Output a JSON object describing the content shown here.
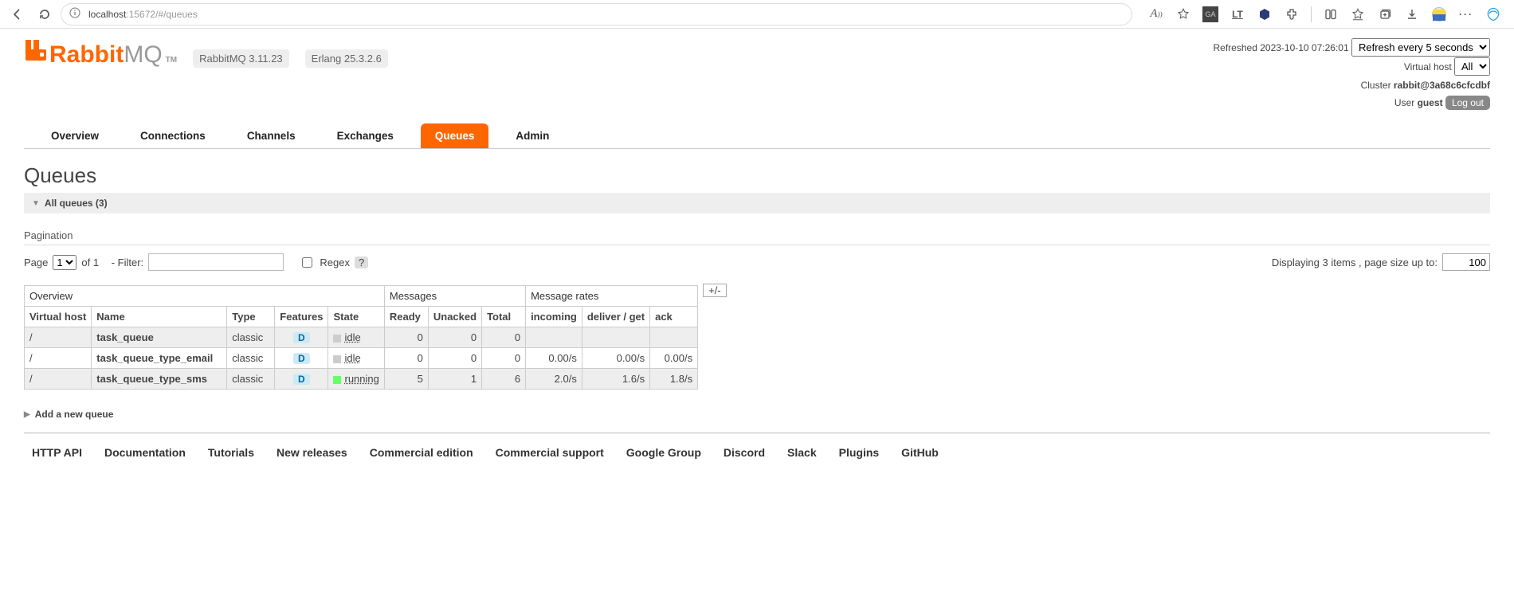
{
  "browser": {
    "url_host": "localhost",
    "url_port_path": ":15672/#/queues"
  },
  "brand": {
    "name": "Rabbit",
    "mq": "MQ",
    "tm": "TM"
  },
  "versions": {
    "rmq": "RabbitMQ 3.11.23",
    "erlang": "Erlang 25.3.2.6"
  },
  "status": {
    "refreshed_label": "Refreshed",
    "refreshed_time": "2023-10-10 07:26:01",
    "refresh_option": "Refresh every 5 seconds",
    "vhost_label": "Virtual host",
    "vhost_option": "All",
    "cluster_label": "Cluster",
    "cluster_value": "rabbit@3a68c6cfcdbf",
    "user_label": "User",
    "user_value": "guest",
    "logout": "Log out"
  },
  "tabs": {
    "overview": "Overview",
    "connections": "Connections",
    "channels": "Channels",
    "exchanges": "Exchanges",
    "queues": "Queues",
    "admin": "Admin"
  },
  "page_title": "Queues",
  "all_queues_label": "All queues (3)",
  "pagination": {
    "label": "Pagination",
    "page_label": "Page",
    "page_value": "1",
    "of_label": "of 1",
    "filter_label": "- Filter:",
    "regex_label": "Regex",
    "regex_help": "?",
    "display_label": "Displaying 3 items , page size up to:",
    "page_size": "100"
  },
  "table": {
    "plusminus": "+/-",
    "group_overview": "Overview",
    "group_messages": "Messages",
    "group_rates": "Message rates",
    "cols": {
      "vhost": "Virtual host",
      "name": "Name",
      "type": "Type",
      "features": "Features",
      "state": "State",
      "ready": "Ready",
      "unacked": "Unacked",
      "total": "Total",
      "incoming": "incoming",
      "deliver": "deliver / get",
      "ack": "ack"
    },
    "rows": [
      {
        "vhost": "/",
        "name": "task_queue",
        "type": "classic",
        "feat": "D",
        "state": "idle",
        "state_kind": "idle",
        "ready": "0",
        "unacked": "0",
        "total": "0",
        "incoming": "",
        "deliver": "",
        "ack": ""
      },
      {
        "vhost": "/",
        "name": "task_queue_type_email",
        "type": "classic",
        "feat": "D",
        "state": "idle",
        "state_kind": "idle",
        "ready": "0",
        "unacked": "0",
        "total": "0",
        "incoming": "0.00/s",
        "deliver": "0.00/s",
        "ack": "0.00/s"
      },
      {
        "vhost": "/",
        "name": "task_queue_type_sms",
        "type": "classic",
        "feat": "D",
        "state": "running",
        "state_kind": "run",
        "ready": "5",
        "unacked": "1",
        "total": "6",
        "incoming": "2.0/s",
        "deliver": "1.6/s",
        "ack": "1.8/s"
      }
    ]
  },
  "add_new": "Add a new queue",
  "footer": {
    "http_api": "HTTP API",
    "docs": "Documentation",
    "tutorials": "Tutorials",
    "new_releases": "New releases",
    "commercial_edition": "Commercial edition",
    "commercial_support": "Commercial support",
    "google_group": "Google Group",
    "discord": "Discord",
    "slack": "Slack",
    "plugins": "Plugins",
    "github": "GitHub"
  }
}
